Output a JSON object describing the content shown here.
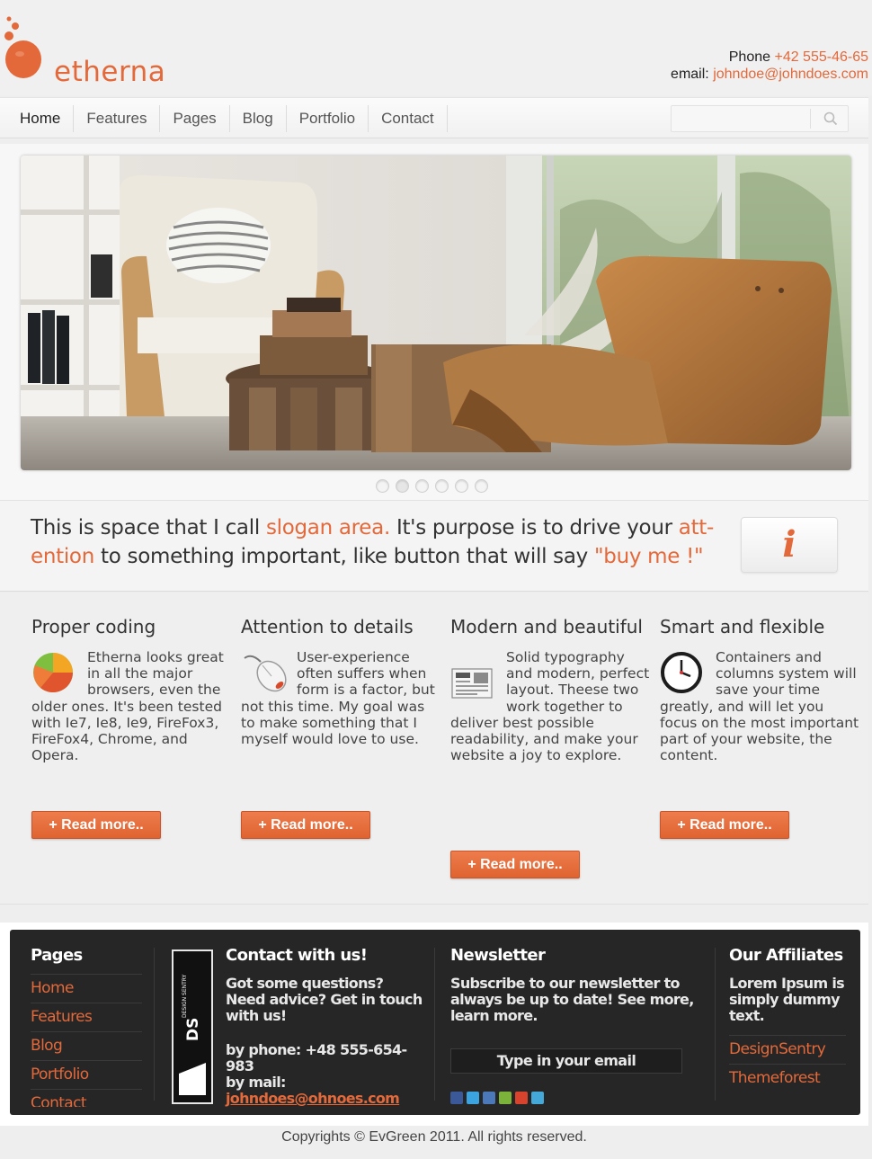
{
  "site": {
    "logo_text": "etherna",
    "phone_label": "Phone",
    "phone": "+42 555-46-65",
    "email_label": "email:",
    "email": "johndoe@johndoes.com",
    "accent_color": "#e3693a"
  },
  "nav": {
    "items": [
      "Home",
      "Features",
      "Pages",
      "Blog",
      "Portfolio",
      "Contact"
    ],
    "search_placeholder": ""
  },
  "slider": {
    "slide_count": 6,
    "active_index": 1
  },
  "slogan": {
    "p1": "This is space that I call ",
    "hl1": "slogan area.",
    "p2": " It's purpose is to drive your ",
    "hl2a": "att-",
    "hl2b": "ention",
    "p3": " to something important, like button that will say ",
    "hl3": "\"buy me !\"",
    "button_icon": "i"
  },
  "features": [
    {
      "title": "Proper coding",
      "icon": "pie-chart-icon",
      "text": "Etherna looks great in all the major browsers, even the older ones. It's been tested with Ie7, Ie8, Ie9, FireFox3, FireFox4, Chrome, and Opera.",
      "button": "+ Read more.."
    },
    {
      "title": "Attention to details",
      "icon": "mouse-icon",
      "text": "User-experience often suffers when form is a factor, but not this time. My goal was to make something that I myself would love to use.",
      "button": "+ Read more.."
    },
    {
      "title": "Modern and beautiful",
      "icon": "newspaper-icon",
      "text": "Solid typography and modern, perfect layout. Theese two work together to deliver best possible readability, and make your website a joy to explore.",
      "button": "+ Read more.."
    },
    {
      "title": "Smart and flexible",
      "icon": "clock-icon",
      "text": "Containers and columns system will save your time greatly, and will let you focus on the most important part of your website, the content.",
      "button": "+ Read more.."
    }
  ],
  "footer": {
    "pages_title": "Pages",
    "pages_links": [
      "Home",
      "Features",
      "Blog",
      "Portfolio",
      "Contact"
    ],
    "badge_text": "DS",
    "badge_sub": "DESIGN SENTRY",
    "contact_title": "Contact with us!",
    "contact_text": "Got some questions? Need advice? Get in touch with us!",
    "contact_phone": "by phone: +48 555-654-983",
    "contact_mail_label": "by mail:",
    "contact_mail": "johndoes@ohnoes.com",
    "newsletter_title": "Newsletter",
    "newsletter_text": "Subscribe to our newsletter to always be up to date! See more, learn more.",
    "newsletter_placeholder": "Type in your email",
    "affiliates_title": "Our Affiliates",
    "affiliates_text": "Lorem Ipsum is simply dummy text.",
    "affiliates_links": [
      "DesignSentry",
      "Themeforest"
    ]
  },
  "copyright": "Copyrights © EvGreen 2011. All rights reserved."
}
